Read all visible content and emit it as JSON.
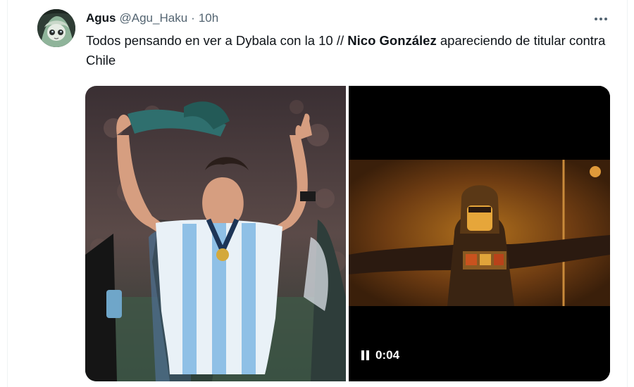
{
  "tweet": {
    "author": {
      "display_name": "Agus",
      "handle": "@Agu_Haku",
      "separator": "·",
      "time": "10h",
      "avatar_icon": "avatar-image"
    },
    "more_icon": "more-options-icon",
    "text": {
      "part1": "Todos pensando en ver a Dybala con la 10 // ",
      "bold": "Nico González",
      "part2": " apareciendo de titular contra Chile"
    },
    "media": {
      "photo_icon": "soccer-player-celebrating-photo",
      "video_icon": "concert-performer-video",
      "video_time": "0:04",
      "video_state_icon": "pause-icon"
    }
  },
  "colors": {
    "text_primary": "#0f1419",
    "text_secondary": "#536471",
    "video_background": "#000000"
  }
}
